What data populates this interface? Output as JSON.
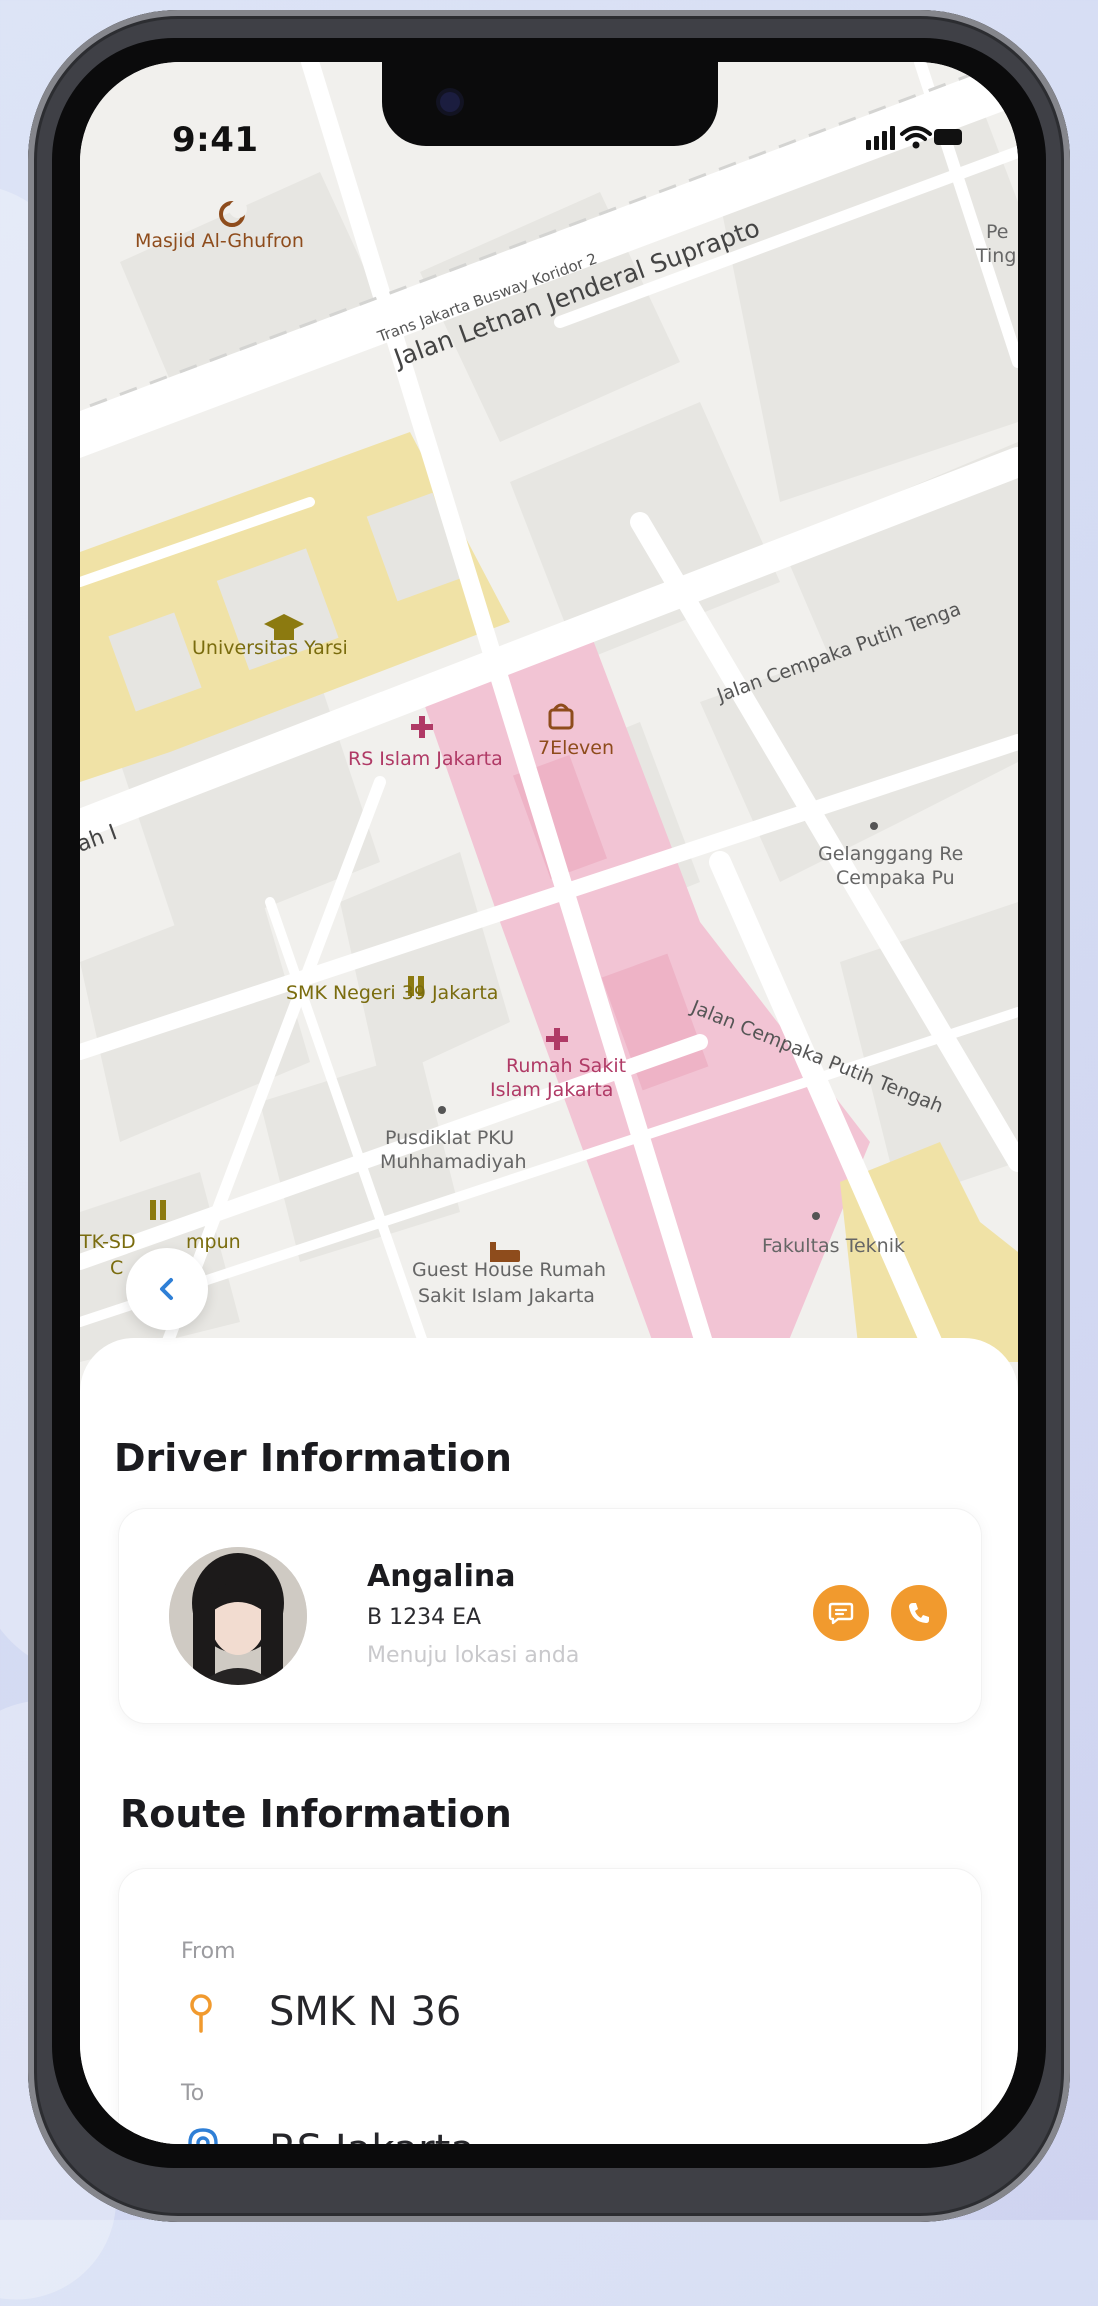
{
  "status_bar": {
    "time": "9:41"
  },
  "map": {
    "labels": {
      "masjid": "Masjid Al-Ghufron",
      "busway": "Trans Jakarta Busway Koridor 2",
      "suprapto": "Jalan Letnan Jenderal Suprapto",
      "universitas": "Universitas Yarsi",
      "rs_islam": "RS Islam Jakarta",
      "seven_eleven": "7Eleven",
      "cempaka_top": "Jalan Cempaka Putih Tenga",
      "gelanggang_1": "Gelanggang Re",
      "gelanggang_2": "Cempaka Pu",
      "smk": "SMK Negeri 39 Jakarta",
      "rumah_sakit_1": "Rumah Sakit",
      "rumah_sakit_2": "Islam Jakarta",
      "pusdiklat_1": "Pusdiklat PKU",
      "pusdiklat_2": "Muhhamadiyah",
      "cempaka_bottom": "Jalan Cempaka Putih Tengah",
      "tk_sd_1": "TK-SD",
      "tk_sd_2": "mpun",
      "tk_sd_3": "C",
      "fakultas": "Fakultas Teknik",
      "guest_house_1": "Guest House Rumah",
      "guest_house_2": "Sakit Islam Jakarta",
      "ah_i": "ah I",
      "pe": "Pe",
      "ting": "Ting"
    }
  },
  "driver_section": {
    "title": "Driver Information",
    "name": "Angalina",
    "plate": "B 1234 EA",
    "status": "Menuju lokasi anda"
  },
  "route_section": {
    "title": "Route Information",
    "from_label": "From",
    "from_value": "SMK N 36",
    "to_label": "To",
    "to_value": "RS Jakarta"
  },
  "colors": {
    "accent": "#f19a2e",
    "map_road": "#ffffff",
    "map_hospital": "#f2c4d4",
    "map_campus": "#f0e2a6",
    "to_icon": "#2f7fd6"
  },
  "icons": [
    "back-arrow-icon",
    "chat-icon",
    "phone-icon",
    "location-pin-icon",
    "target-pin-icon",
    "signal-icon",
    "wifi-icon",
    "battery-icon",
    "hospital-icon",
    "school-icon",
    "mosque-icon",
    "store-icon",
    "hotel-icon"
  ]
}
